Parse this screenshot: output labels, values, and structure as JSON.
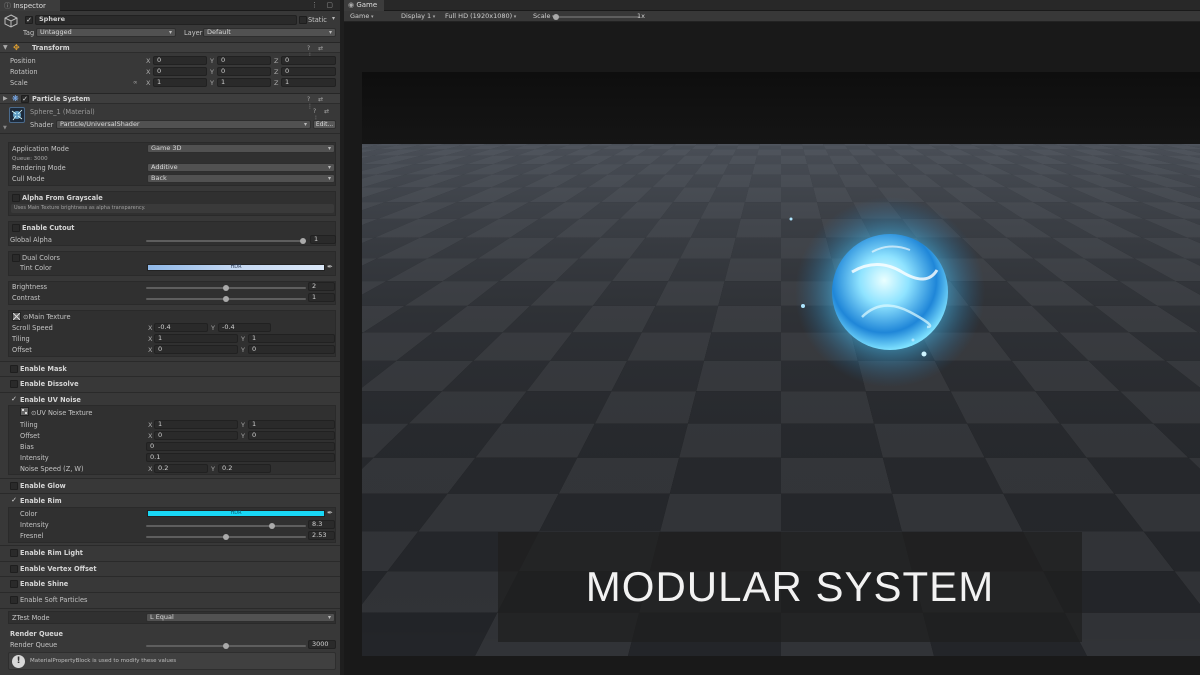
{
  "inspector": {
    "tab_label": "Inspector",
    "tab_icons": "⋮ ▢",
    "object": {
      "name": "Sphere",
      "static_label": "Static",
      "tag_label": "Tag",
      "tag_value": "Untagged",
      "layer_label": "Layer",
      "layer_value": "Default"
    },
    "transform": {
      "title": "Transform",
      "rows": [
        {
          "label": "Position",
          "x": "0",
          "y": "0",
          "z": "0"
        },
        {
          "label": "Rotation",
          "x": "0",
          "y": "0",
          "z": "0"
        },
        {
          "label": "Scale",
          "x": "1",
          "y": "1",
          "z": "1"
        }
      ],
      "axis_x": "X",
      "axis_y": "Y",
      "axis_z": "Z",
      "constrain_icon_text": "∞"
    },
    "particle_system": {
      "title": "Particle System"
    },
    "material": {
      "name": "Sphere_1 (Material)",
      "shader_label": "Shader",
      "shader_value": "Particle/UniversalShader",
      "edit_label": "Edit..."
    },
    "props": {
      "application_mode_label": "Application Mode",
      "application_mode_value": "Game 3D",
      "queue_text": "Queue: 3000",
      "rendering_mode_label": "Rendering Mode",
      "rendering_mode_value": "Additive",
      "cull_mode_label": "Cull Mode",
      "cull_mode_value": "Back",
      "alpha_from_grayscale": "Alpha From Grayscale",
      "alpha_hint": "Uses Main Texture brightness as alpha transparency.",
      "enable_cutout": "Enable Cutout",
      "global_alpha_label": "Global Alpha",
      "global_alpha_value": "1",
      "global_alpha_level": 1.0,
      "dual_colors": "Dual Colors",
      "tint_color_label": "Tint Color",
      "hdr": "HDR",
      "brightness_label": "Brightness",
      "brightness_value": "2",
      "brightness_level": 0.5,
      "contrast_label": "Contrast",
      "contrast_value": "1",
      "contrast_level": 0.5,
      "main_texture": "⊙Main Texture",
      "scroll_speed_label": "Scroll Speed",
      "scroll_x": "-0.4",
      "scroll_y": "-0.4",
      "tiling_label": "Tiling",
      "tiling_x": "1",
      "tiling_y": "1",
      "offset_label": "Offset",
      "offset_x": "0",
      "offset_y": "0",
      "enable_mask": "Enable Mask",
      "enable_dissolve": "Enable Dissolve",
      "enable_uv_noise": "Enable UV Noise",
      "uv_noise_texture": "⊙UV Noise Texture",
      "noise_tiling_x": "1",
      "noise_tiling_y": "1",
      "noise_offset_x": "0",
      "noise_offset_y": "0",
      "bias_label": "Bias",
      "bias_value": "0",
      "intensity_label": "Intensity",
      "intensity_value": "0.1",
      "noise_speed_label": "Noise Speed (Z, W)",
      "noise_speed_x": "0.2",
      "noise_speed_y": "0.2",
      "enable_glow": "Enable Glow",
      "enable_rim": "Enable Rim",
      "rim_color_label": "Color",
      "rim_intensity_label": "Intensity",
      "rim_intensity_value": "8.3",
      "rim_intensity_level": 0.8,
      "fresnel_label": "Fresnel",
      "fresnel_value": "2.53",
      "fresnel_level": 0.5,
      "enable_rim_light": "Enable Rim Light",
      "enable_vertex_offset": "Enable Vertex Offset",
      "enable_shine": "Enable Shine",
      "enable_soft_particles": "Enable Soft Particles",
      "ztest_label": "ZTest Mode",
      "ztest_value": "L Equal",
      "render_queue_header": "Render Queue",
      "render_queue_label": "Render Queue",
      "render_queue_value": "3000",
      "render_queue_level": 0.5,
      "info_text": "MaterialPropertyBlock is used to modify these values",
      "axis_x": "X",
      "axis_y": "Y"
    }
  },
  "game": {
    "tab_label": "Game",
    "toolbar": {
      "mode": "Game",
      "display": "Display 1",
      "resolution": "Full HD (1920x1080)",
      "scale_label": "Scale",
      "scale_value": "1x"
    },
    "banner_text": "MODULAR SYSTEM"
  },
  "colors": {
    "tint_gradient_start": "#8fb8e8",
    "tint_gradient_end": "#dbe8f8",
    "rim_color": "#19d7f5",
    "orb_glow": "#49c8ff"
  }
}
